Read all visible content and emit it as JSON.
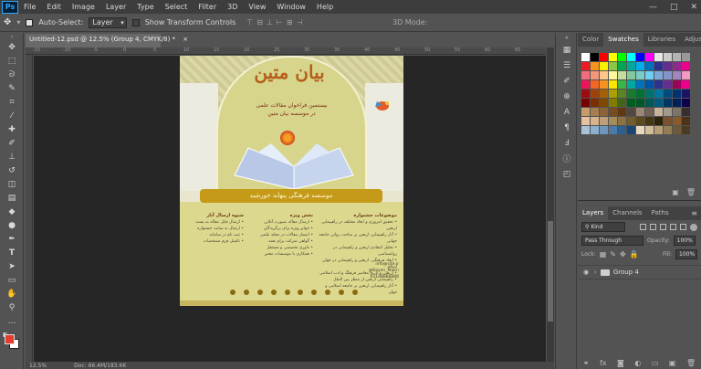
{
  "app": {
    "logo": "Ps"
  },
  "menu": [
    "File",
    "Edit",
    "Image",
    "Layer",
    "Type",
    "Select",
    "Filter",
    "3D",
    "View",
    "Window",
    "Help"
  ],
  "window_controls": {
    "minimize": "—",
    "maximize": "□",
    "close": "✕"
  },
  "options_bar": {
    "auto_select_label": "Auto-Select:",
    "auto_select_value": "Layer",
    "show_transform_label": "Show Transform Controls",
    "mode_3d_label": "3D Mode:"
  },
  "document": {
    "tab_title": "Untitled-12.psd @ 12.5% (Group 4, CMYK/8) *",
    "close": "×",
    "ruler_ticks": [
      "-15",
      "-10",
      "-5",
      "0",
      "5",
      "10",
      "15",
      "20",
      "25",
      "30",
      "35",
      "40",
      "45",
      "50",
      "55",
      "60",
      "65"
    ]
  },
  "status": {
    "zoom": "12.5%",
    "doc_size": "Doc: 66.4M/183.6K"
  },
  "poster": {
    "calligraphy": "بیان متین",
    "subtitle_line1": "بیستمین فراخوان مقالات علمی",
    "subtitle_line2": "در موسسه بیان متین",
    "banner": "موسسه فرهنگی پنهانه خورشید",
    "col1_head": "موضوعات جشنواره",
    "col1_items": [
      "• تحقیق امروزی و ابعاد مختلف در راهپیمایی اربعین",
      "• آثار راهپیمایی اربعین بر ساحت روانی جامعه جهانی",
      "• تحلیل انتقادی اربعین و راهپیمایی در روانشناسی",
      "• ابعاد فرهنگی، اربعین و راهپیمایی در جهان اسلام",
      "• اربعین و تاریخ معاصر فرهنگ و ادب اسلامی",
      "• راهپیمایی اربعین از منظر بین الملل",
      "• آثار راهپیمایی اربعین بر جامعه اسلامی و جهان"
    ],
    "col2_head": "بخش ویژه",
    "col2_items": [
      "• ارسال مقاله بصورت آنلاین",
      "• جوایز ویژه برای برگزیدگان",
      "• انتشار مقالات در مجله علمی",
      "• گواهی شرکت برای همه",
      "• داوری تخصصی و مستقل",
      "• همکاری با موسسات معتبر"
    ],
    "col3_head": "شیوه ارسال آثار",
    "col3_items": [
      "• ارسال فایل مقاله به پست",
      "• ارسال به سایت جشنواره",
      "• ثبت نام در سامانه",
      "• تکمیل فرم مشخصات"
    ],
    "contact": [
      "info@site.ir",
      "@Bayan_Matin",
      "02188888888"
    ]
  },
  "swatches_panel": {
    "tabs": [
      "Color",
      "Swatches",
      "Libraries",
      "Adjustme"
    ],
    "active_tab": "Swatches",
    "colors": [
      "#ffffff",
      "#000000",
      "#ff0000",
      "#ffff00",
      "#00ff00",
      "#00ffff",
      "#0000ff",
      "#ff00ff",
      "#e6e6e6",
      "#cccccc",
      "#b3b3b3",
      "#999999",
      "#ed1c24",
      "#f7941d",
      "#fff200",
      "#8dc63f",
      "#00a651",
      "#00a99d",
      "#00aeef",
      "#0072bc",
      "#2e3192",
      "#662d91",
      "#92278f",
      "#ec008c",
      "#f26d7d",
      "#f69679",
      "#fdc68a",
      "#fff799",
      "#c4df9b",
      "#82ca9c",
      "#7accc8",
      "#6dcff6",
      "#7ea7d8",
      "#8493ca",
      "#a186be",
      "#f49ac2",
      "#ed145b",
      "#f26522",
      "#f7941d",
      "#ffe600",
      "#39b54a",
      "#00a99d",
      "#0072bc",
      "#0054a6",
      "#2e3192",
      "#662d91",
      "#9e005d",
      "#ed008c",
      "#9e0b0f",
      "#a0410d",
      "#a36209",
      "#aba000",
      "#598527",
      "#197b30",
      "#007236",
      "#00746b",
      "#0076a3",
      "#004a80",
      "#003471",
      "#1b1464",
      "#790000",
      "#7b2e00",
      "#7d4900",
      "#827b00",
      "#406618",
      "#005e20",
      "#005826",
      "#005952",
      "#005b7f",
      "#003663",
      "#002157",
      "#0d004c",
      "#c69c6d",
      "#a67c52",
      "#8c6239",
      "#754c24",
      "#603913",
      "#534741",
      "#998675",
      "#736357",
      "#c7b299",
      "#a3988c",
      "#7d7468",
      "#362f2d",
      "#e6c2a0",
      "#d9b38c",
      "#bf9f7a",
      "#a68b5b",
      "#8c7240",
      "#735c2d",
      "#5c4a1f",
      "#453614",
      "#2e240b",
      "#7a5230",
      "#8a5c2c",
      "#4d3319",
      "#a9c2d8",
      "#8fb0cc",
      "#6d97bc",
      "#4a7aa6",
      "#2d5f8f",
      "#1a4673",
      "#e8d8c0",
      "#d1bd9a",
      "#b59d74",
      "#957d55",
      "#6e5a3a",
      "#4a3b22"
    ]
  },
  "layers_panel": {
    "tabs": [
      "Layers",
      "Channels",
      "Paths"
    ],
    "active_tab": "Layers",
    "kind_label": "Kind",
    "blend_mode": "Pass Through",
    "opacity_label": "Opacity:",
    "opacity_value": "100%",
    "lock_label": "Lock:",
    "fill_label": "Fill:",
    "fill_value": "100%",
    "layers": [
      {
        "name": "Group 4",
        "type": "group"
      }
    ],
    "footer_icons": [
      "link-icon",
      "fx-icon",
      "mask-icon",
      "adjustment-icon",
      "folder-icon",
      "new-layer-icon",
      "trash-icon"
    ]
  },
  "colors": {
    "foreground": "#e63b2e",
    "background": "#ffffff"
  }
}
